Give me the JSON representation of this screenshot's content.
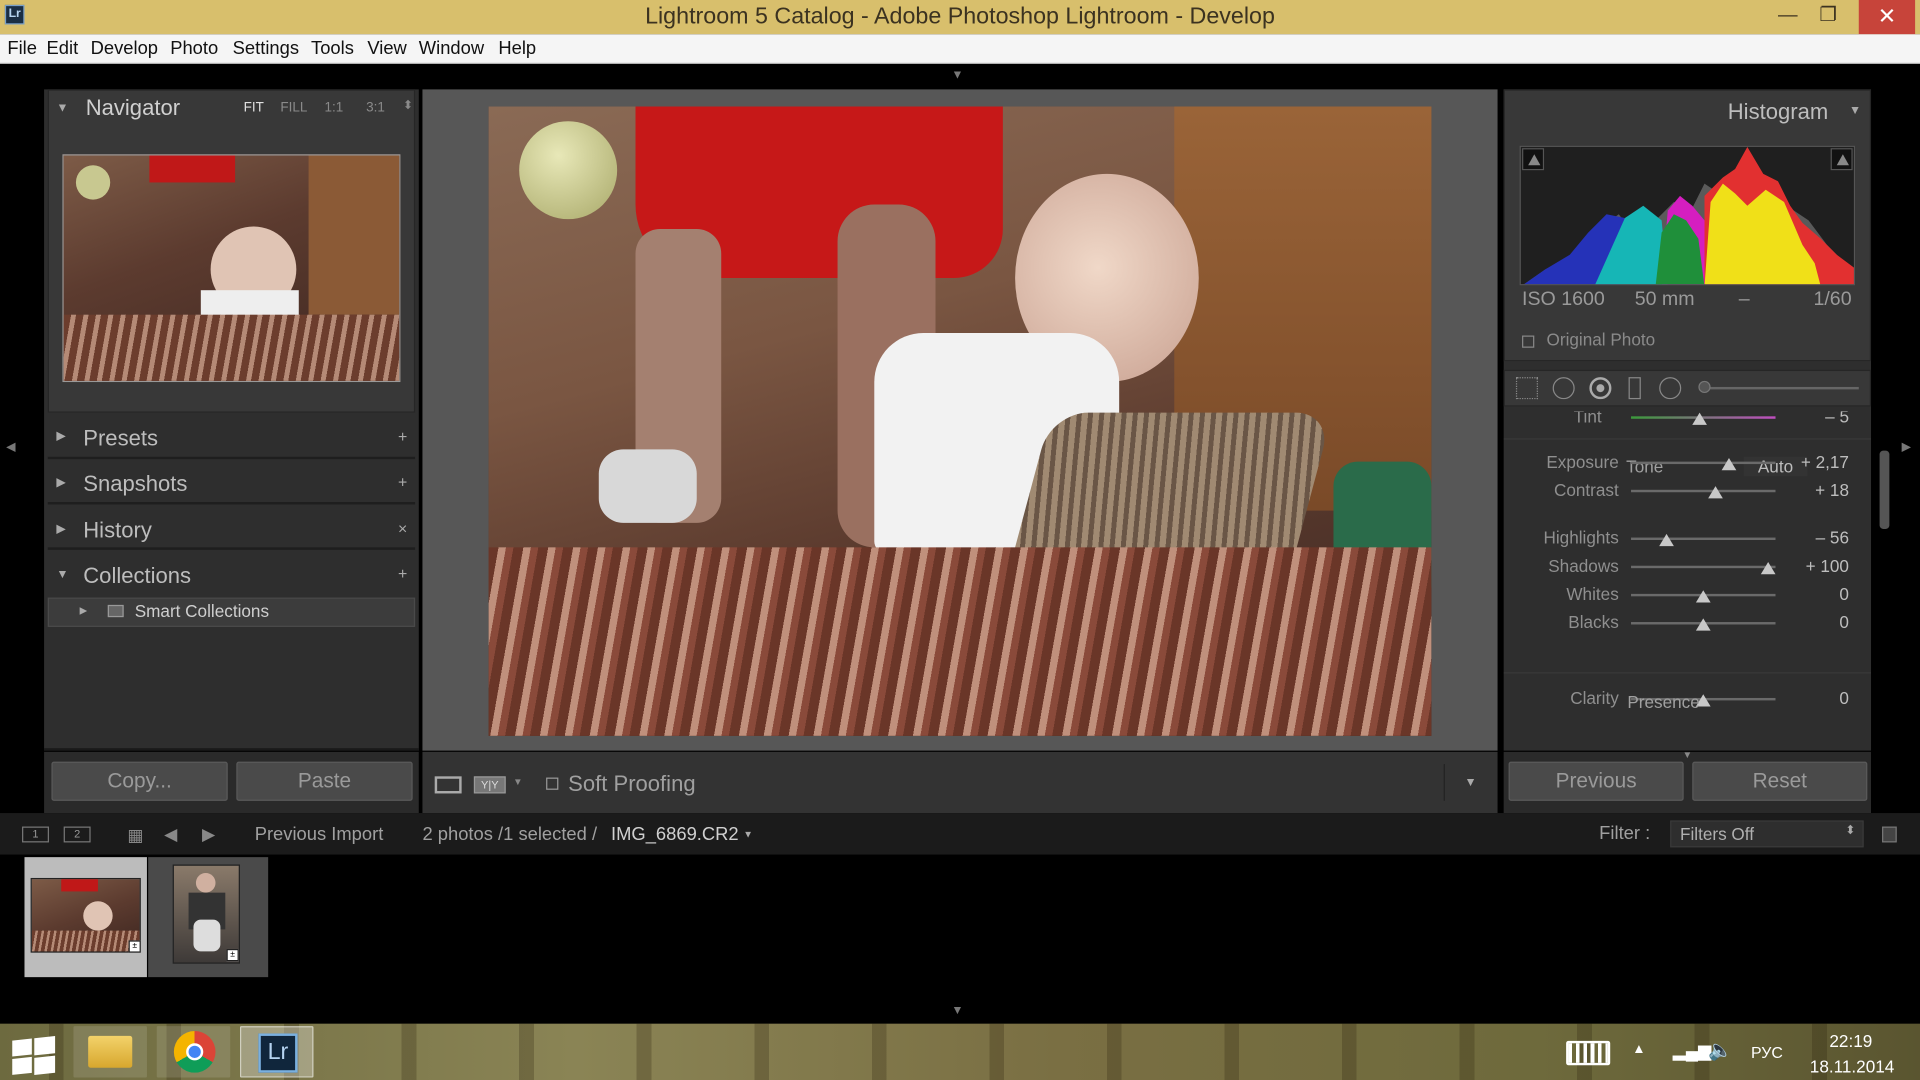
{
  "window": {
    "title": "Lightroom 5 Catalog - Adobe Photoshop Lightroom - Develop",
    "app_icon": "Lr"
  },
  "menu": [
    "File",
    "Edit",
    "Develop",
    "Photo",
    "Settings",
    "Tools",
    "View",
    "Window",
    "Help"
  ],
  "navigator": {
    "title": "Navigator",
    "zoom": [
      "FIT",
      "FILL",
      "1:1",
      "3:1"
    ]
  },
  "left_sections": [
    {
      "label": "Presets",
      "action": "+"
    },
    {
      "label": "Snapshots",
      "action": "+"
    },
    {
      "label": "History",
      "action": "×"
    },
    {
      "label": "Collections",
      "action": "+"
    }
  ],
  "collections": {
    "item": "Smart Collections"
  },
  "left_buttons": {
    "copy": "Copy...",
    "paste": "Paste"
  },
  "toolbar": {
    "soft_proofing": "Soft Proofing"
  },
  "histogram": {
    "title": "Histogram",
    "iso": "ISO 1600",
    "focal": "50 mm",
    "dash": "–",
    "shutter": "1/60",
    "original_photo": "Original Photo"
  },
  "basic": {
    "tint": {
      "label": "Tint",
      "value": "– 5"
    },
    "tone_label": "Tone",
    "auto": "Auto",
    "presence_label": "Presence",
    "sliders": [
      {
        "label": "Exposure",
        "value": "+ 2,17",
        "pos": 0.7
      },
      {
        "label": "Contrast",
        "value": "+ 18",
        "pos": 0.59
      },
      {
        "label": "Highlights",
        "value": "– 56",
        "pos": 0.22
      },
      {
        "label": "Shadows",
        "value": "+ 100",
        "pos": 1.0
      },
      {
        "label": "Whites",
        "value": "0",
        "pos": 0.5
      },
      {
        "label": "Blacks",
        "value": "0",
        "pos": 0.5
      },
      {
        "label": "Clarity",
        "value": "0",
        "pos": 0.5
      }
    ]
  },
  "right_buttons": {
    "previous": "Previous",
    "reset": "Reset"
  },
  "filmstrip": {
    "views": [
      "1",
      "2"
    ],
    "source": "Previous Import",
    "info": "2 photos /1 selected /",
    "file": "IMG_6869.CR2",
    "filter_label": "Filter :",
    "filter_value": "Filters Off"
  },
  "taskbar": {
    "lang": "РУС",
    "time": "22:19",
    "date": "18.11.2014",
    "lr": "Lr"
  },
  "colors": {
    "titlebar": "#d8bf6c",
    "close": "#c7443a",
    "panel": "#2e2e2e",
    "center": "#575757"
  }
}
